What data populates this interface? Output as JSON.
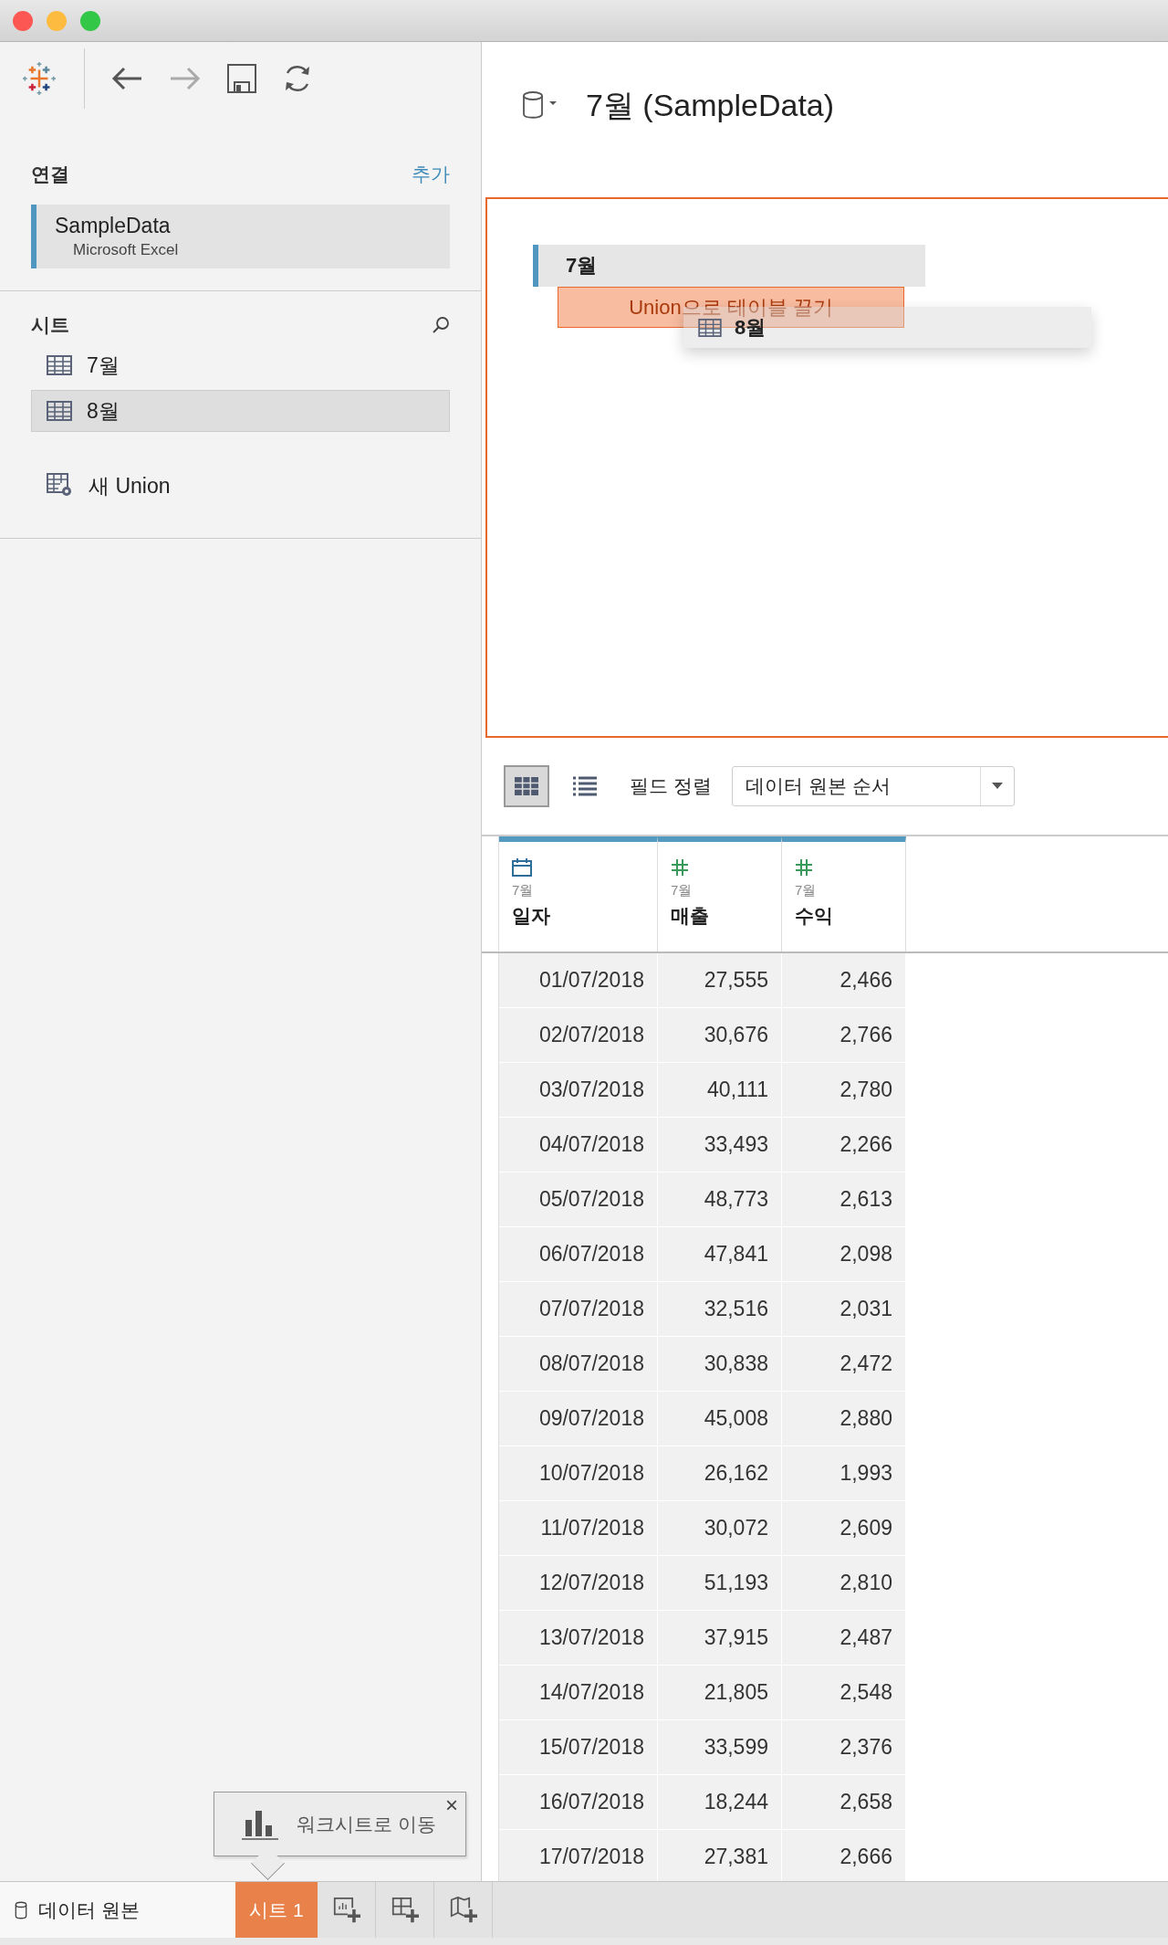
{
  "toolbar": {
    "back": {
      "disabled": false
    },
    "forward": {
      "disabled": true
    }
  },
  "connections": {
    "heading": "연결",
    "add_link": "추가",
    "items": [
      {
        "name": "SampleData",
        "type": "Microsoft Excel"
      }
    ]
  },
  "sheets": {
    "heading": "시트",
    "items": [
      {
        "label": "7월",
        "selected": false
      },
      {
        "label": "8월",
        "selected": true
      }
    ],
    "new_union": "새 Union"
  },
  "data_source": {
    "title": "7월 (SampleData)"
  },
  "canvas": {
    "tables": [
      {
        "label": "7월"
      }
    ],
    "drop_hint": "Union으로 테이블 끌기",
    "dragging": {
      "label": "8월"
    }
  },
  "grid_toolbar": {
    "views": [
      {
        "kind": "grid",
        "selected": true
      },
      {
        "kind": "list",
        "selected": false
      }
    ],
    "sort_label": "필드 정렬",
    "sort_value": "데이터 원본 순서"
  },
  "table": {
    "columns": [
      {
        "kind": "date",
        "source": "7월",
        "name": "일자"
      },
      {
        "kind": "number",
        "source": "7월",
        "name": "매출"
      },
      {
        "kind": "number",
        "source": "7월",
        "name": "수익"
      }
    ],
    "rows": [
      [
        "01/07/2018",
        "27,555",
        "2,466"
      ],
      [
        "02/07/2018",
        "30,676",
        "2,766"
      ],
      [
        "03/07/2018",
        "40,111",
        "2,780"
      ],
      [
        "04/07/2018",
        "33,493",
        "2,266"
      ],
      [
        "05/07/2018",
        "48,773",
        "2,613"
      ],
      [
        "06/07/2018",
        "47,841",
        "2,098"
      ],
      [
        "07/07/2018",
        "32,516",
        "2,031"
      ],
      [
        "08/07/2018",
        "30,838",
        "2,472"
      ],
      [
        "09/07/2018",
        "45,008",
        "2,880"
      ],
      [
        "10/07/2018",
        "26,162",
        "1,993"
      ],
      [
        "11/07/2018",
        "30,072",
        "2,609"
      ],
      [
        "12/07/2018",
        "51,193",
        "2,810"
      ],
      [
        "13/07/2018",
        "37,915",
        "2,487"
      ],
      [
        "14/07/2018",
        "21,805",
        "2,548"
      ],
      [
        "15/07/2018",
        "33,599",
        "2,376"
      ],
      [
        "16/07/2018",
        "18,244",
        "2,658"
      ],
      [
        "17/07/2018",
        "27,381",
        "2,666"
      ]
    ]
  },
  "tooltip": {
    "text": "워크시트로 이동",
    "close": "×"
  },
  "bottom_bar": {
    "data_source": "데이터 원본",
    "sheets": [
      {
        "label": "시트 1",
        "selected": true
      }
    ],
    "new_buttons": [
      {
        "kind": "worksheet"
      },
      {
        "kind": "dashboard"
      },
      {
        "kind": "story"
      }
    ]
  }
}
